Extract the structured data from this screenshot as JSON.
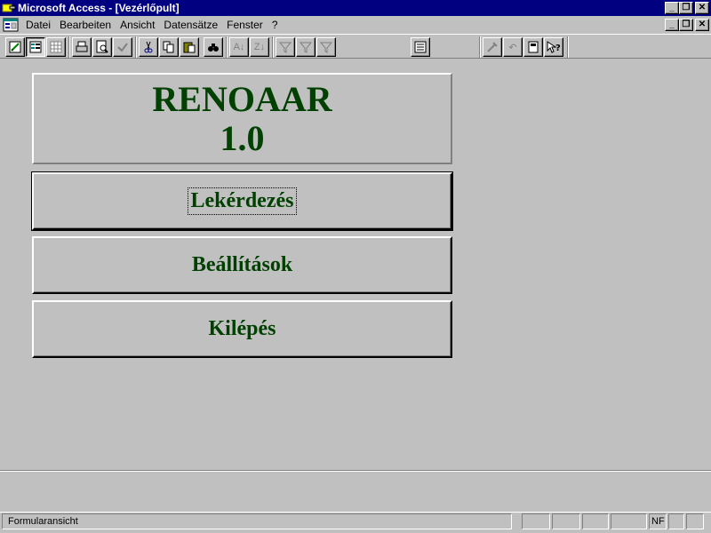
{
  "window": {
    "title": "Microsoft Access - [Vezérlőpult]",
    "controls": [
      "_",
      "❐",
      "✕"
    ]
  },
  "menu": {
    "items": [
      {
        "label": "Datei"
      },
      {
        "label": "Bearbeiten"
      },
      {
        "label": "Ansicht"
      },
      {
        "label": "Datensätze"
      },
      {
        "label": "Fenster"
      },
      {
        "label": "?"
      }
    ]
  },
  "toolbar": {
    "buttons": [
      {
        "icon": "design-view-icon"
      },
      {
        "icon": "form-view-icon"
      },
      {
        "icon": "datasheet-view-icon"
      },
      {
        "icon": "print-icon"
      },
      {
        "icon": "print-preview-icon"
      },
      {
        "icon": "spelling-icon"
      },
      {
        "icon": "cut-icon"
      },
      {
        "icon": "copy-icon"
      },
      {
        "icon": "paste-icon"
      },
      {
        "icon": "find-icon"
      },
      {
        "icon": "sort-ascending-icon"
      },
      {
        "icon": "sort-descending-icon"
      },
      {
        "icon": "filter-by-selection-icon"
      },
      {
        "icon": "filter-by-form-icon"
      },
      {
        "icon": "apply-filter-icon"
      },
      {
        "icon": "properties-icon"
      },
      {
        "icon": "build-icon"
      },
      {
        "icon": "undo-icon"
      },
      {
        "icon": "database-window-icon"
      },
      {
        "icon": "help-icon"
      }
    ]
  },
  "form": {
    "title_line1": "RENOAAR",
    "title_line2": "1.0",
    "buttons": [
      {
        "label": "Lekérdezés"
      },
      {
        "label": "Beállítások"
      },
      {
        "label": "Kilépés"
      }
    ],
    "text_color": "#004000"
  },
  "statusbar": {
    "text": "Formularansicht",
    "indicator": "NF"
  }
}
